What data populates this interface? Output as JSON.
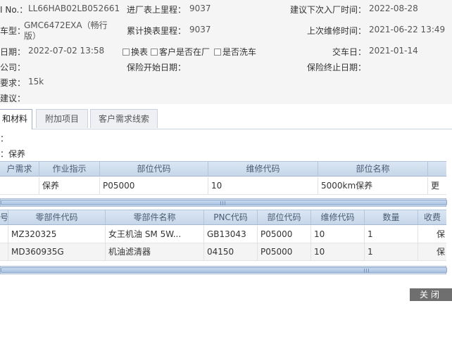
{
  "vehicle_info": {
    "vin_label": "I No.：",
    "vin_value": "LL66HAB02LB052661",
    "model_label": "车型：",
    "model_value_line1": "GMC6472EXA（畅行",
    "model_value_line2": "版）",
    "date_label": "日期：",
    "date_value": "2022-07-02 13:58",
    "company_label": "公司：",
    "request_label": "要求：",
    "request_value": "15k",
    "advice_label": "建议：",
    "odometer_label": "进厂表上里程：",
    "odometer_value": "9037",
    "total_mileage_label": "累计换表里程：",
    "total_mileage_value": "9037",
    "checkbox_swap_label": "换表",
    "checkbox_in_factory_label": "客户是否在厂",
    "checkbox_wash_label": "是否洗车",
    "insurance_start_label": "保险开始日期：",
    "next_visit_label": "建议下次入厂时间：",
    "next_visit_value": "2022-08-28",
    "last_repair_label": "上次维修时间：",
    "last_repair_value": "2021-06-22 13:49",
    "delivery_label": "交车日：",
    "delivery_value": "2021-01-14",
    "insurance_end_label": "保险终止日期："
  },
  "tabs": [
    "和材料",
    "附加项目",
    "客户需求线索"
  ],
  "section": {
    "colon_line": "：",
    "type_line": "：保养"
  },
  "work_table": {
    "headers": [
      "户需求",
      "作业指示",
      "部位代码",
      "维修代码",
      "部位名称"
    ],
    "rows": [
      {
        "instruction": "保养",
        "part_code": "P05000",
        "repair_code": "10",
        "part_name": "5000km保养",
        "extra": "更换"
      }
    ]
  },
  "parts_table": {
    "headers": [
      "号",
      "零部件代码",
      "零部件名称",
      "PNC代码",
      "部位代码",
      "维修代码",
      "数量",
      "收费"
    ],
    "rows": [
      {
        "code": "MZ320325",
        "name": "女王机油 SM 5W...",
        "pnc": "GB13043",
        "part_code": "P05000",
        "repair_code": "10",
        "qty": "1",
        "fee": "保"
      },
      {
        "code": "MD360935G",
        "name": "机油滤清器",
        "pnc": "04150",
        "part_code": "P05000",
        "repair_code": "10",
        "qty": "1",
        "fee": "保"
      }
    ]
  },
  "close_button_label": "关闭"
}
